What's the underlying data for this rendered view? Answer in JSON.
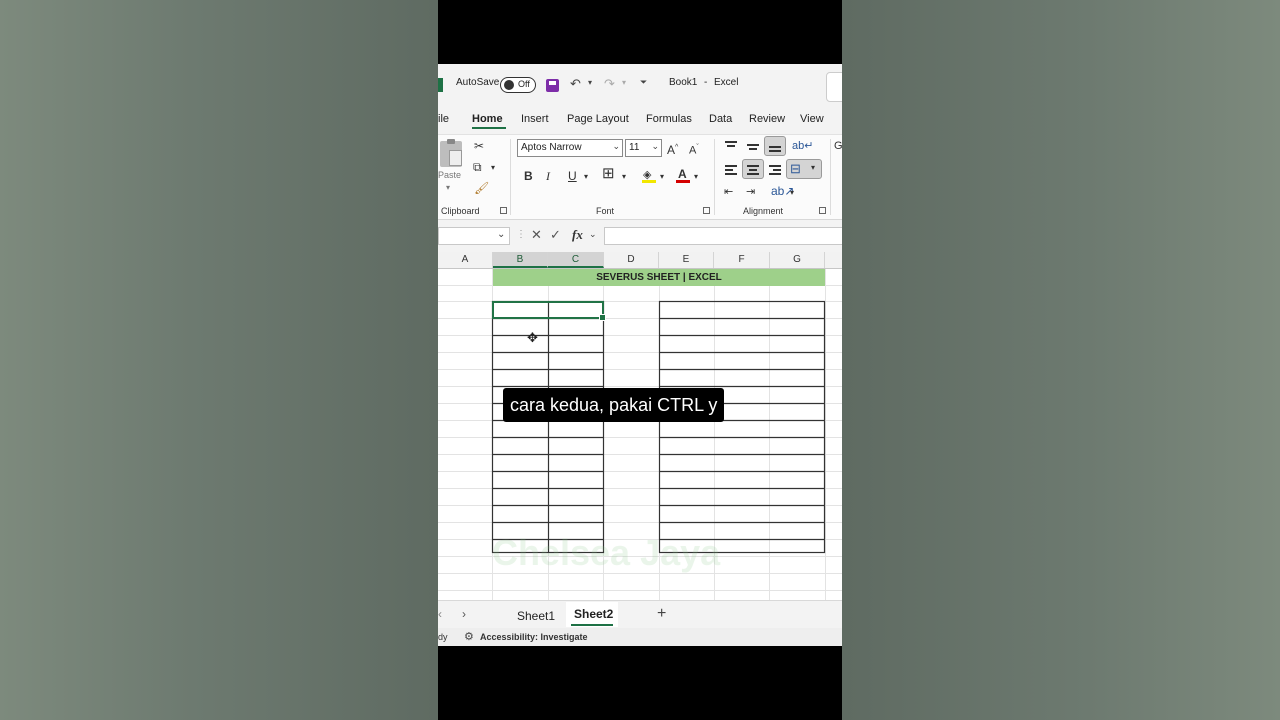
{
  "titlebar": {
    "autosave_label": "AutoSave",
    "autosave_state": "Off",
    "book_title": "Book1",
    "title_sep": "-",
    "app_name": "Excel"
  },
  "tabs": [
    "ile",
    "Home",
    "Insert",
    "Page Layout",
    "Formulas",
    "Data",
    "Review",
    "View"
  ],
  "active_tab": "Home",
  "ribbon": {
    "clipboard": {
      "paste_label": "Paste",
      "group_label": "Clipboard"
    },
    "font": {
      "family": "Aptos Narrow",
      "size": "11",
      "bold": "B",
      "italic": "I",
      "underline": "U",
      "group_label": "Font"
    },
    "alignment": {
      "group_label": "Alignment"
    }
  },
  "formula_bar": {
    "fx": "fx",
    "value": ""
  },
  "columns": [
    "A",
    "B",
    "C",
    "D",
    "E",
    "F",
    "G"
  ],
  "selected_columns": [
    "B",
    "C"
  ],
  "banner_text": "SEVERUS SHEET | EXCEL",
  "caption": "cara kedua, pakai CTRL y",
  "watermark": "Chelsea Jaya",
  "sheets": [
    "Sheet1",
    "Sheet2"
  ],
  "active_sheet": "Sheet2",
  "status": {
    "ready": "dy",
    "accessibility": "Accessibility: Investigate"
  },
  "colors": {
    "excel_green": "#1e7145",
    "banner": "#9ed08a",
    "selection": "#217346"
  }
}
